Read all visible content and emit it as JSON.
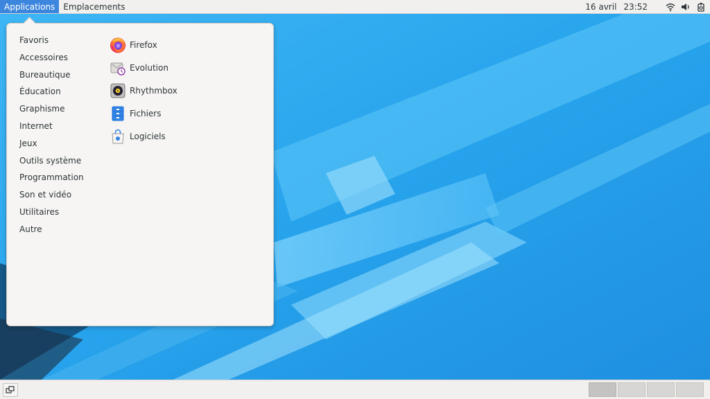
{
  "top_panel": {
    "menus": [
      {
        "label": "Applications",
        "active": true
      },
      {
        "label": "Emplacements",
        "active": false
      }
    ],
    "clock": {
      "date": "16 avril",
      "time": "23:52"
    },
    "tray_icons": [
      "wifi-icon",
      "volume-icon",
      "power-icon"
    ]
  },
  "app_menu": {
    "categories": [
      "Favoris",
      "Accessoires",
      "Bureautique",
      "Éducation",
      "Graphisme",
      "Internet",
      "Jeux",
      "Outils système",
      "Programmation",
      "Son et vidéo",
      "Utilitaires",
      "Autre"
    ],
    "apps": [
      {
        "label": "Firefox",
        "icon": "firefox-icon"
      },
      {
        "label": "Evolution",
        "icon": "evolution-icon"
      },
      {
        "label": "Rhythmbox",
        "icon": "rhythmbox-icon"
      },
      {
        "label": "Fichiers",
        "icon": "files-icon"
      },
      {
        "label": "Logiciels",
        "icon": "software-icon"
      }
    ]
  },
  "bottom_panel": {
    "workspace_count": 4,
    "active_workspace": 1
  },
  "colors": {
    "wallpaper": "#2aa7ee",
    "panel": "#f1f0ef",
    "menu_active": "#3d86de",
    "menu_bg": "#f6f5f4"
  }
}
